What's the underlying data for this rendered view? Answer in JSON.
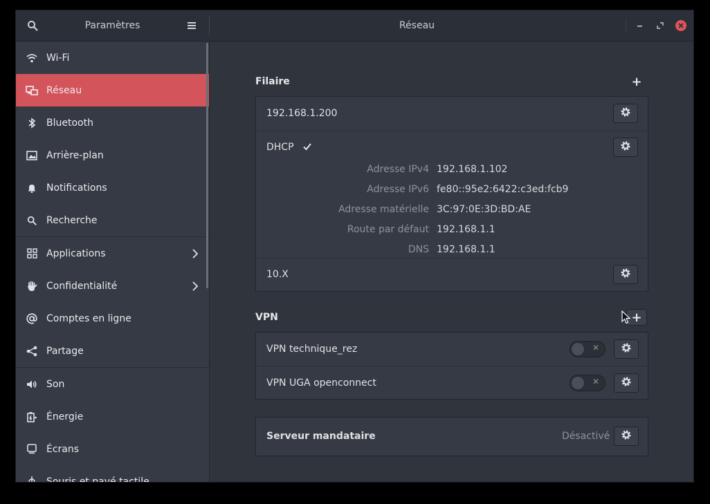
{
  "header": {
    "left_title": "Paramètres",
    "right_title": "Réseau",
    "icons": [
      "search-icon",
      "menu-icon",
      "minimize-icon",
      "restore-icon",
      "close-icon"
    ]
  },
  "sidebar": {
    "items": [
      {
        "label": "Wi-Fi",
        "icon": "wifi-icon"
      },
      {
        "label": "Réseau",
        "icon": "network-icon",
        "active": true
      },
      {
        "label": "Bluetooth",
        "icon": "bluetooth-icon"
      },
      {
        "label": "Arrière-plan",
        "icon": "background-icon"
      },
      {
        "label": "Notifications",
        "icon": "bell-icon"
      },
      {
        "label": "Recherche",
        "icon": "search-icon"
      },
      {
        "label": "Applications",
        "icon": "apps-icon",
        "chevron": true
      },
      {
        "label": "Confidentialité",
        "icon": "hand-icon",
        "chevron": true
      },
      {
        "label": "Comptes en ligne",
        "icon": "at-icon"
      },
      {
        "label": "Partage",
        "icon": "share-icon"
      },
      {
        "label": "Son",
        "icon": "speaker-icon"
      },
      {
        "label": "Énergie",
        "icon": "power-icon"
      },
      {
        "label": "Écrans",
        "icon": "display-icon"
      },
      {
        "label": "Souris et pavé tactile",
        "icon": "mouse-icon"
      }
    ]
  },
  "wired": {
    "title": "Filaire",
    "add_label": "+",
    "rows": [
      {
        "label": "192.168.1.200"
      },
      {
        "label": "DHCP",
        "checked": true
      },
      {
        "label": "10.X"
      }
    ],
    "details": [
      {
        "key": "Adresse IPv4",
        "value": "192.168.1.102"
      },
      {
        "key": "Adresse IPv6",
        "value": "fe80::95e2:6422:c3ed:fcb9"
      },
      {
        "key": "Adresse matérielle",
        "value": "3C:97:0E:3D:BD:AE"
      },
      {
        "key": "Route par défaut",
        "value": "192.168.1.1"
      },
      {
        "key": "DNS",
        "value": "192.168.1.1"
      }
    ]
  },
  "vpn": {
    "title": "VPN",
    "add_label": "+",
    "rows": [
      {
        "label": "VPN technique_rez",
        "enabled": false
      },
      {
        "label": "VPN UGA openconnect",
        "enabled": false
      }
    ]
  },
  "proxy": {
    "label": "Serveur mandataire",
    "status": "Désactivé"
  },
  "colors": {
    "accent": "#d4545b",
    "background": "#2f343d",
    "sidebar": "#353a44",
    "close_button": "#e0535a"
  }
}
